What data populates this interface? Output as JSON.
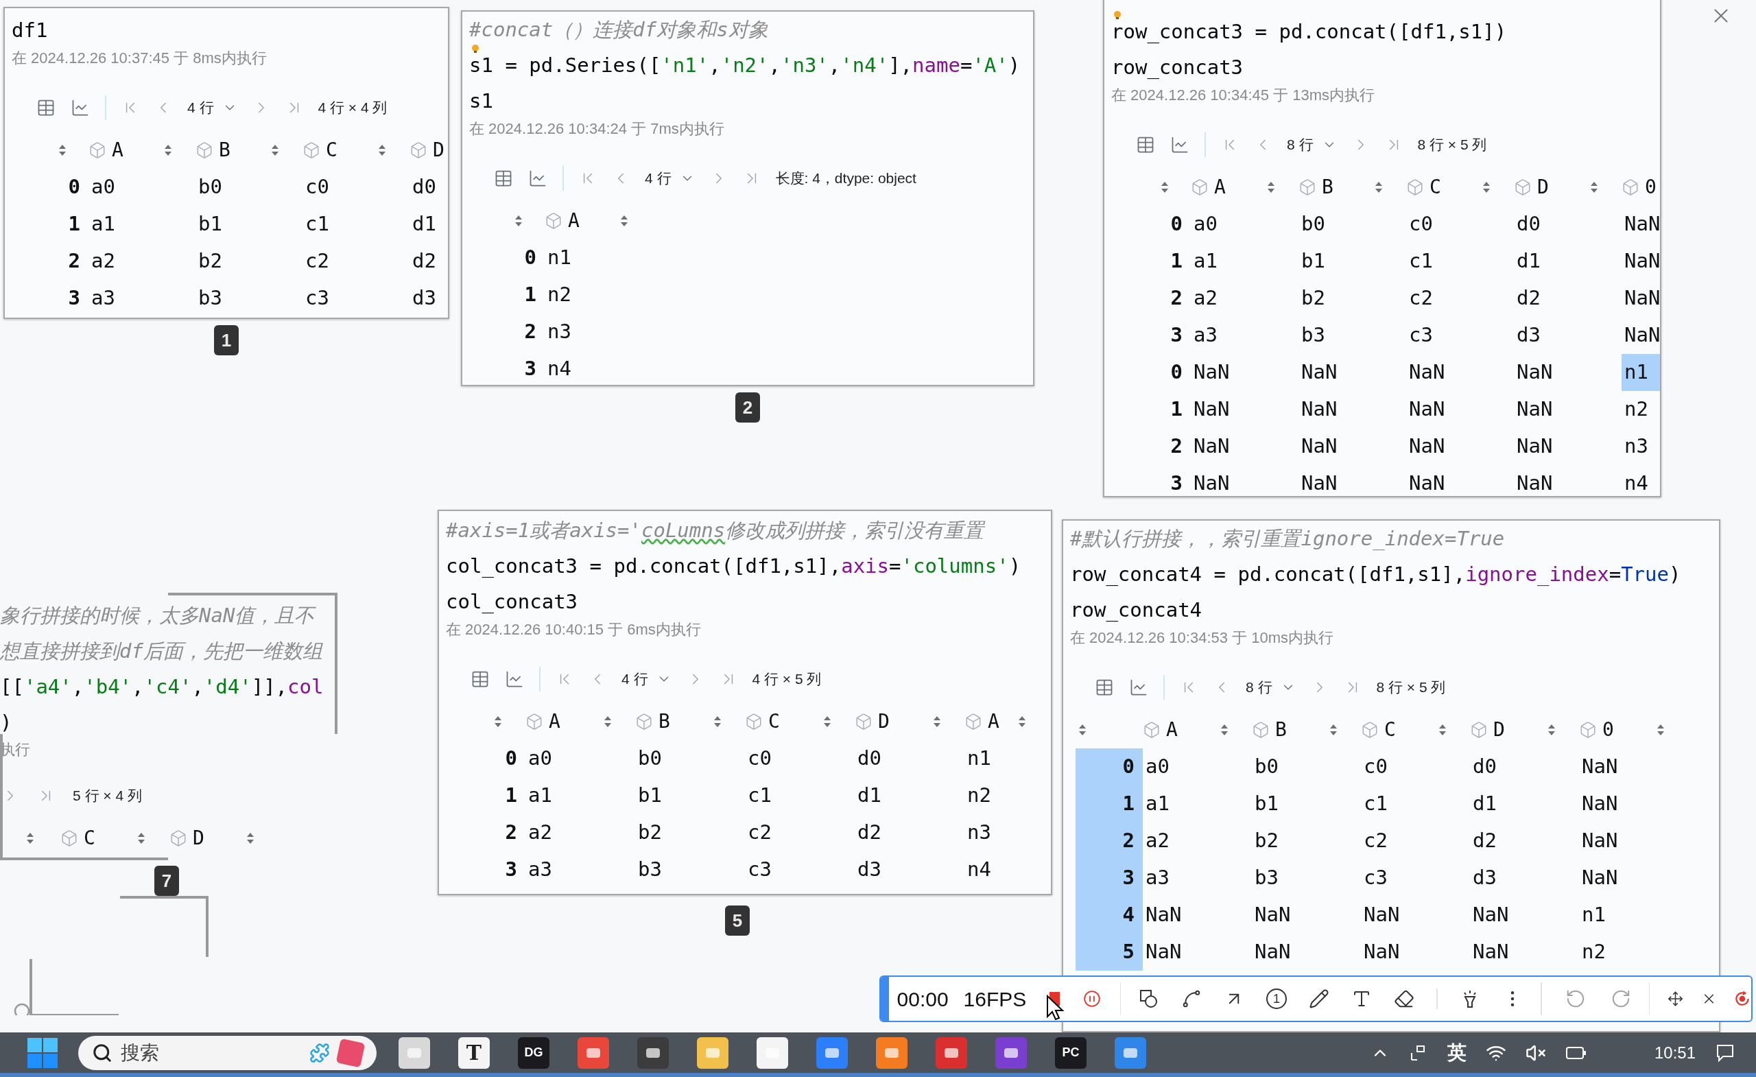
{
  "cards": [
    {
      "kind": "output",
      "code_lines": [
        {
          "hint_bulb": false,
          "tokens": [
            {
              "kind": "plain",
              "text": "df1"
            }
          ]
        }
      ],
      "exec_info": "在 2024.12.26 10:37:45 于 8ms内执行",
      "rows_select": "4 行",
      "summary": "4 行 × 4 列",
      "columns": [
        "A",
        "B",
        "C",
        "D"
      ],
      "index_highlighted": false,
      "rows": [
        {
          "index": "0",
          "cells": [
            {
              "text": "a0",
              "selected": false
            },
            {
              "text": "b0",
              "selected": false
            },
            {
              "text": "c0",
              "selected": false
            },
            {
              "text": "d0",
              "selected": false
            }
          ]
        },
        {
          "index": "1",
          "cells": [
            {
              "text": "a1",
              "selected": false
            },
            {
              "text": "b1",
              "selected": false
            },
            {
              "text": "c1",
              "selected": false
            },
            {
              "text": "d1",
              "selected": false
            }
          ]
        },
        {
          "index": "2",
          "cells": [
            {
              "text": "a2",
              "selected": false
            },
            {
              "text": "b2",
              "selected": false
            },
            {
              "text": "c2",
              "selected": false
            },
            {
              "text": "d2",
              "selected": false
            }
          ]
        },
        {
          "index": "3",
          "cells": [
            {
              "text": "a3",
              "selected": false
            },
            {
              "text": "b3",
              "selected": false
            },
            {
              "text": "c3",
              "selected": false
            },
            {
              "text": "d3",
              "selected": false
            }
          ]
        }
      ],
      "badge": "1"
    },
    {
      "kind": "output",
      "code_lines": [
        {
          "hint_bulb": false,
          "tokens": [
            {
              "kind": "comment",
              "text": "#concat（）连接df对象和s对象"
            }
          ]
        },
        {
          "hint_bulb": true,
          "tokens": [
            {
              "kind": "plain",
              "text": "s1 = pd.Series(["
            },
            {
              "kind": "string",
              "text": "'n1'"
            },
            {
              "kind": "plain",
              "text": ","
            },
            {
              "kind": "string",
              "text": "'n2'"
            },
            {
              "kind": "plain",
              "text": ","
            },
            {
              "kind": "string",
              "text": "'n3'"
            },
            {
              "kind": "plain",
              "text": ","
            },
            {
              "kind": "string",
              "text": "'n4'"
            },
            {
              "kind": "plain",
              "text": "],"
            },
            {
              "kind": "keyword",
              "text": "name"
            },
            {
              "kind": "plain",
              "text": "="
            },
            {
              "kind": "string",
              "text": "'A'"
            },
            {
              "kind": "plain",
              "text": ")"
            }
          ]
        },
        {
          "hint_bulb": false,
          "tokens": [
            {
              "kind": "plain",
              "text": "s1"
            }
          ]
        }
      ],
      "exec_info": "在 2024.12.26 10:34:24 于 7ms内执行",
      "rows_select": "4 行",
      "summary": "长度: 4，dtype: object",
      "columns": [
        "A"
      ],
      "index_highlighted": false,
      "rows": [
        {
          "index": "0",
          "cells": [
            {
              "text": "n1",
              "selected": false
            }
          ]
        },
        {
          "index": "1",
          "cells": [
            {
              "text": "n2",
              "selected": false
            }
          ]
        },
        {
          "index": "2",
          "cells": [
            {
              "text": "n3",
              "selected": false
            }
          ]
        },
        {
          "index": "3",
          "cells": [
            {
              "text": "n4",
              "selected": false
            }
          ]
        }
      ],
      "badge": "2"
    },
    {
      "kind": "output",
      "code_lines": [
        {
          "hint_bulb": true,
          "tokens": [
            {
              "kind": "plain",
              "text": "row_concat3 = pd.concat([df1,s1])"
            }
          ]
        },
        {
          "hint_bulb": false,
          "tokens": [
            {
              "kind": "plain",
              "text": "row_concat3"
            }
          ]
        }
      ],
      "exec_info": "在 2024.12.26 10:34:45 于 13ms内执行",
      "rows_select": "8 行",
      "summary": "8 行 × 5 列",
      "columns": [
        "A",
        "B",
        "C",
        "D",
        "0"
      ],
      "index_highlighted": false,
      "rows": [
        {
          "index": "0",
          "cells": [
            {
              "text": "a0",
              "selected": false
            },
            {
              "text": "b0",
              "selected": false
            },
            {
              "text": "c0",
              "selected": false
            },
            {
              "text": "d0",
              "selected": false
            },
            {
              "text": "NaN",
              "selected": false
            }
          ]
        },
        {
          "index": "1",
          "cells": [
            {
              "text": "a1",
              "selected": false
            },
            {
              "text": "b1",
              "selected": false
            },
            {
              "text": "c1",
              "selected": false
            },
            {
              "text": "d1",
              "selected": false
            },
            {
              "text": "NaN",
              "selected": false
            }
          ]
        },
        {
          "index": "2",
          "cells": [
            {
              "text": "a2",
              "selected": false
            },
            {
              "text": "b2",
              "selected": false
            },
            {
              "text": "c2",
              "selected": false
            },
            {
              "text": "d2",
              "selected": false
            },
            {
              "text": "NaN",
              "selected": false
            }
          ]
        },
        {
          "index": "3",
          "cells": [
            {
              "text": "a3",
              "selected": false
            },
            {
              "text": "b3",
              "selected": false
            },
            {
              "text": "c3",
              "selected": false
            },
            {
              "text": "d3",
              "selected": false
            },
            {
              "text": "NaN",
              "selected": false
            }
          ]
        },
        {
          "index": "0",
          "cells": [
            {
              "text": "NaN",
              "selected": false
            },
            {
              "text": "NaN",
              "selected": false
            },
            {
              "text": "NaN",
              "selected": false
            },
            {
              "text": "NaN",
              "selected": false
            },
            {
              "text": "n1",
              "selected": true
            }
          ]
        },
        {
          "index": "1",
          "cells": [
            {
              "text": "NaN",
              "selected": false
            },
            {
              "text": "NaN",
              "selected": false
            },
            {
              "text": "NaN",
              "selected": false
            },
            {
              "text": "NaN",
              "selected": false
            },
            {
              "text": "n2",
              "selected": false
            }
          ]
        },
        {
          "index": "2",
          "cells": [
            {
              "text": "NaN",
              "selected": false
            },
            {
              "text": "NaN",
              "selected": false
            },
            {
              "text": "NaN",
              "selected": false
            },
            {
              "text": "NaN",
              "selected": false
            },
            {
              "text": "n3",
              "selected": false
            }
          ]
        },
        {
          "index": "3",
          "cells": [
            {
              "text": "NaN",
              "selected": false
            },
            {
              "text": "NaN",
              "selected": false
            },
            {
              "text": "NaN",
              "selected": false
            },
            {
              "text": "NaN",
              "selected": false
            },
            {
              "text": "n4",
              "selected": false
            }
          ]
        }
      ]
    },
    {
      "kind": "clipped",
      "code_lines": [
        {
          "hint_bulb": false,
          "tokens": [
            {
              "kind": "comment",
              "text": "象行拼接的时候，太多NaN值，且不"
            }
          ]
        },
        {
          "hint_bulb": false,
          "tokens": [
            {
              "kind": "comment",
              "text": "想直接拼接到df后面，先把一维数组"
            }
          ]
        },
        {
          "hint_bulb": false,
          "tokens": [
            {
              "kind": "plain",
              "text": "[["
            },
            {
              "kind": "string",
              "text": "'a4'"
            },
            {
              "kind": "plain",
              "text": ","
            },
            {
              "kind": "string",
              "text": "'b4'"
            },
            {
              "kind": "plain",
              "text": ","
            },
            {
              "kind": "string",
              "text": "'c4'"
            },
            {
              "kind": "plain",
              "text": ","
            },
            {
              "kind": "string",
              "text": "'d4'"
            },
            {
              "kind": "plain",
              "text": "]],"
            },
            {
              "kind": "keyword",
              "text": "col"
            }
          ]
        },
        {
          "hint_bulb": false,
          "tokens": [
            {
              "kind": "plain",
              "text": ")"
            }
          ]
        }
      ],
      "exec_info": "执行",
      "summary": "5 行 × 4 列",
      "columns": [
        "C",
        "D"
      ],
      "badge": "7"
    },
    {
      "kind": "output",
      "code_lines": [
        {
          "hint_bulb": false,
          "tokens": [
            {
              "kind": "comment",
              "text": "#axis=1或者axis='"
            },
            {
              "kind": "comment_flagged",
              "text": "coLumns"
            },
            {
              "kind": "comment",
              "text": "修改成列拼接，索引没有重置"
            }
          ]
        },
        {
          "hint_bulb": false,
          "tokens": [
            {
              "kind": "plain",
              "text": "col_concat3 = pd.concat([df1,s1],"
            },
            {
              "kind": "keyword",
              "text": "axis"
            },
            {
              "kind": "plain",
              "text": "="
            },
            {
              "kind": "string",
              "text": "'columns'"
            },
            {
              "kind": "plain",
              "text": ")"
            }
          ]
        },
        {
          "hint_bulb": false,
          "tokens": [
            {
              "kind": "plain",
              "text": "col_concat3"
            }
          ]
        }
      ],
      "exec_info": "在 2024.12.26 10:40:15 于 6ms内执行",
      "rows_select": "4 行",
      "summary": "4 行 × 5 列",
      "columns": [
        "A",
        "B",
        "C",
        "D",
        "A"
      ],
      "index_highlighted": false,
      "rows": [
        {
          "index": "0",
          "cells": [
            {
              "text": "a0",
              "selected": false
            },
            {
              "text": "b0",
              "selected": false
            },
            {
              "text": "c0",
              "selected": false
            },
            {
              "text": "d0",
              "selected": false
            },
            {
              "text": "n1",
              "selected": false
            }
          ]
        },
        {
          "index": "1",
          "cells": [
            {
              "text": "a1",
              "selected": false
            },
            {
              "text": "b1",
              "selected": false
            },
            {
              "text": "c1",
              "selected": false
            },
            {
              "text": "d1",
              "selected": false
            },
            {
              "text": "n2",
              "selected": false
            }
          ]
        },
        {
          "index": "2",
          "cells": [
            {
              "text": "a2",
              "selected": false
            },
            {
              "text": "b2",
              "selected": false
            },
            {
              "text": "c2",
              "selected": false
            },
            {
              "text": "d2",
              "selected": false
            },
            {
              "text": "n3",
              "selected": false
            }
          ]
        },
        {
          "index": "3",
          "cells": [
            {
              "text": "a3",
              "selected": false
            },
            {
              "text": "b3",
              "selected": false
            },
            {
              "text": "c3",
              "selected": false
            },
            {
              "text": "d3",
              "selected": false
            },
            {
              "text": "n4",
              "selected": false
            }
          ]
        }
      ],
      "badge": "5"
    },
    {
      "kind": "output",
      "code_lines": [
        {
          "hint_bulb": false,
          "tokens": [
            {
              "kind": "comment",
              "text": "#默认行拼接，，索引重置ignore_index=True"
            }
          ]
        },
        {
          "hint_bulb": false,
          "tokens": [
            {
              "kind": "plain",
              "text": "row_concat4 = pd.concat([df1,s1],"
            },
            {
              "kind": "keyword",
              "text": "ignore_index"
            },
            {
              "kind": "plain",
              "text": "="
            },
            {
              "kind": "constant",
              "text": "True"
            },
            {
              "kind": "plain",
              "text": ")"
            }
          ]
        },
        {
          "hint_bulb": false,
          "tokens": [
            {
              "kind": "plain",
              "text": "row_concat4"
            }
          ]
        }
      ],
      "exec_info": "在 2024.12.26 10:34:53 于 10ms内执行",
      "rows_select": "8 行",
      "summary": "8 行 × 5 列",
      "columns": [
        "A",
        "B",
        "C",
        "D",
        "0"
      ],
      "index_highlighted": true,
      "rows": [
        {
          "index": "0",
          "cells": [
            {
              "text": "a0",
              "selected": false
            },
            {
              "text": "b0",
              "selected": false
            },
            {
              "text": "c0",
              "selected": false
            },
            {
              "text": "d0",
              "selected": false
            },
            {
              "text": "NaN",
              "selected": false
            }
          ]
        },
        {
          "index": "1",
          "cells": [
            {
              "text": "a1",
              "selected": false
            },
            {
              "text": "b1",
              "selected": false
            },
            {
              "text": "c1",
              "selected": false
            },
            {
              "text": "d1",
              "selected": false
            },
            {
              "text": "NaN",
              "selected": false
            }
          ]
        },
        {
          "index": "2",
          "cells": [
            {
              "text": "a2",
              "selected": false
            },
            {
              "text": "b2",
              "selected": false
            },
            {
              "text": "c2",
              "selected": false
            },
            {
              "text": "d2",
              "selected": false
            },
            {
              "text": "NaN",
              "selected": false
            }
          ]
        },
        {
          "index": "3",
          "cells": [
            {
              "text": "a3",
              "selected": false
            },
            {
              "text": "b3",
              "selected": false
            },
            {
              "text": "c3",
              "selected": false
            },
            {
              "text": "d3",
              "selected": false
            },
            {
              "text": "NaN",
              "selected": false
            }
          ]
        },
        {
          "index": "4",
          "cells": [
            {
              "text": "NaN",
              "selected": false
            },
            {
              "text": "NaN",
              "selected": false
            },
            {
              "text": "NaN",
              "selected": false
            },
            {
              "text": "NaN",
              "selected": false
            },
            {
              "text": "n1",
              "selected": false
            }
          ]
        },
        {
          "index": "5",
          "cells": [
            {
              "text": "NaN",
              "selected": false
            },
            {
              "text": "NaN",
              "selected": false
            },
            {
              "text": "NaN",
              "selected": false
            },
            {
              "text": "NaN",
              "selected": false
            },
            {
              "text": "n2",
              "selected": false
            }
          ]
        }
      ]
    }
  ],
  "recorder": {
    "timer": "00:00",
    "fps": "16FPS",
    "recording": true,
    "tools": [
      {
        "kind": "shape",
        "disabled": false
      },
      {
        "kind": "path",
        "disabled": false
      },
      {
        "kind": "arrow",
        "disabled": false
      },
      {
        "kind": "number",
        "label": "1",
        "disabled": false
      },
      {
        "kind": "pencil",
        "disabled": false
      },
      {
        "kind": "text",
        "disabled": false
      },
      {
        "kind": "eraser",
        "disabled": false
      },
      {
        "kind": "spotlight",
        "disabled": false
      },
      {
        "kind": "more",
        "disabled": false
      }
    ],
    "history": [
      {
        "kind": "undo",
        "disabled": true
      },
      {
        "kind": "redo",
        "disabled": true
      }
    ]
  },
  "taskbar": {
    "search": {
      "placeholder": "搜索"
    },
    "apps": [
      {
        "kind": "window"
      },
      {
        "kind": "letter",
        "label": "T"
      },
      {
        "kind": "letter_dark",
        "label": "DG"
      },
      {
        "kind": "xmind"
      },
      {
        "kind": "sublime"
      },
      {
        "kind": "folder"
      },
      {
        "kind": "panda"
      },
      {
        "kind": "browser"
      },
      {
        "kind": "network"
      },
      {
        "kind": "wps"
      },
      {
        "kind": "purple"
      },
      {
        "kind": "letter_dark",
        "label": "PC"
      },
      {
        "kind": "monitor"
      }
    ],
    "ime": "英",
    "time": "10:51"
  }
}
